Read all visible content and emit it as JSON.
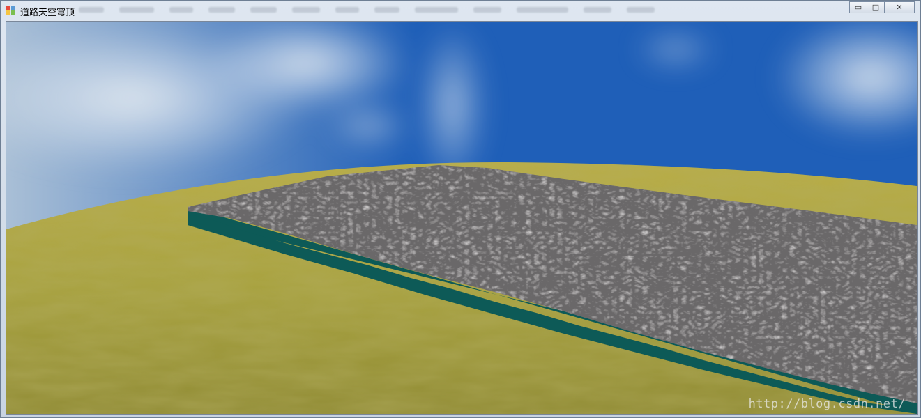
{
  "window": {
    "title": "道路天空穹顶",
    "controls": {
      "minimize": "▭",
      "maximize": "□",
      "close": "✕"
    }
  },
  "viewport": {
    "watermark": "http://blog.csdn.net/"
  },
  "colors": {
    "sky_top": "#1f5fb8",
    "sky_light": "#a9bfd6",
    "grass": "#a7a13d",
    "gravel": "#6a6869",
    "slab_edge": "#0d5a57"
  }
}
